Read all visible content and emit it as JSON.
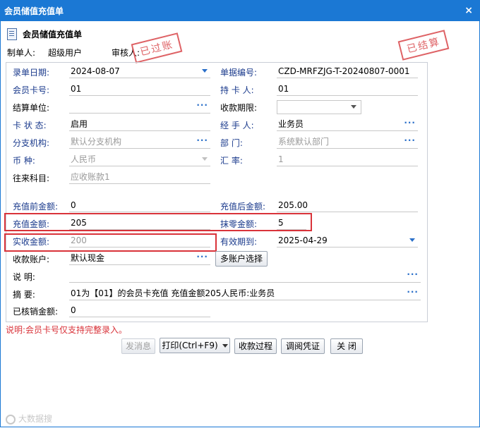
{
  "window": {
    "title": "会员储值充值单",
    "close": "×"
  },
  "header": {
    "title": "会员储值充值单",
    "maker_label": "制单人:",
    "maker": "超级用户",
    "auditor_label": "审核人:"
  },
  "stamps": {
    "posted": "已过账",
    "settled": "已结算"
  },
  "fields": {
    "entry_date": {
      "label": "录单日期:",
      "value": "2024-08-07"
    },
    "doc_no": {
      "label": "单据编号:",
      "value": "CZD-MRFZJG-T-20240807-0001"
    },
    "card_no": {
      "label": "会员卡号:",
      "value": "01"
    },
    "holder": {
      "label": "持 卡 人:",
      "value": "01"
    },
    "settle_unit": {
      "label": "结算单位:",
      "value": ""
    },
    "pay_term": {
      "label": "收款期限:",
      "value": ""
    },
    "card_status": {
      "label": "卡 状 态:",
      "value": "启用"
    },
    "handler": {
      "label": "经 手 人:",
      "value": "业务员"
    },
    "branch": {
      "label": "分支机构:",
      "value": "默认分支机构"
    },
    "department": {
      "label": "部    门:",
      "value": "系统默认部门"
    },
    "currency": {
      "label": "币    种:",
      "value": "人民币"
    },
    "rate": {
      "label": "汇    率:",
      "value": "1"
    },
    "subject": {
      "label": "往来科目:",
      "value": "应收账款1"
    },
    "before_amount": {
      "label": "充值前金额:",
      "value": "0"
    },
    "after_amount": {
      "label": "充值后金额:",
      "value": "205.00"
    },
    "recharge_amount": {
      "label": "充值金额:",
      "value": "205"
    },
    "discount_amount": {
      "label": "抹零金额:",
      "value": "5"
    },
    "received_amount": {
      "label": "实收金额:",
      "value": "200"
    },
    "valid_until": {
      "label": "有效期到:",
      "value": "2025-04-29"
    },
    "account": {
      "label": "收款账户:",
      "value": "默认现金"
    },
    "description": {
      "label": "说    明:",
      "value": ""
    },
    "summary": {
      "label": "摘    要:",
      "value": "01为【01】的会员卡充值 充值金额205人民币:业务员"
    },
    "written_off": {
      "label": "已核销金额:",
      "value": "0"
    }
  },
  "buttons": {
    "multi_account": "多账户选择",
    "send_message": "发消息",
    "print": "打印(Ctrl+F9)",
    "collection_process": "收款过程",
    "view_voucher": "调阅凭证",
    "close": "关 闭"
  },
  "note": "说明:会员卡号仅支持完整录入。",
  "watermark": "大数据搜",
  "icons": [
    "document-icon",
    "close-icon",
    "dropdown-icon",
    "ellipsis-icon"
  ],
  "colors": {
    "title_bar": "#1b78d4",
    "label_blue": "#1a3a8c",
    "stamp_red": "#d9474b",
    "highlight_red": "#d9333a"
  }
}
